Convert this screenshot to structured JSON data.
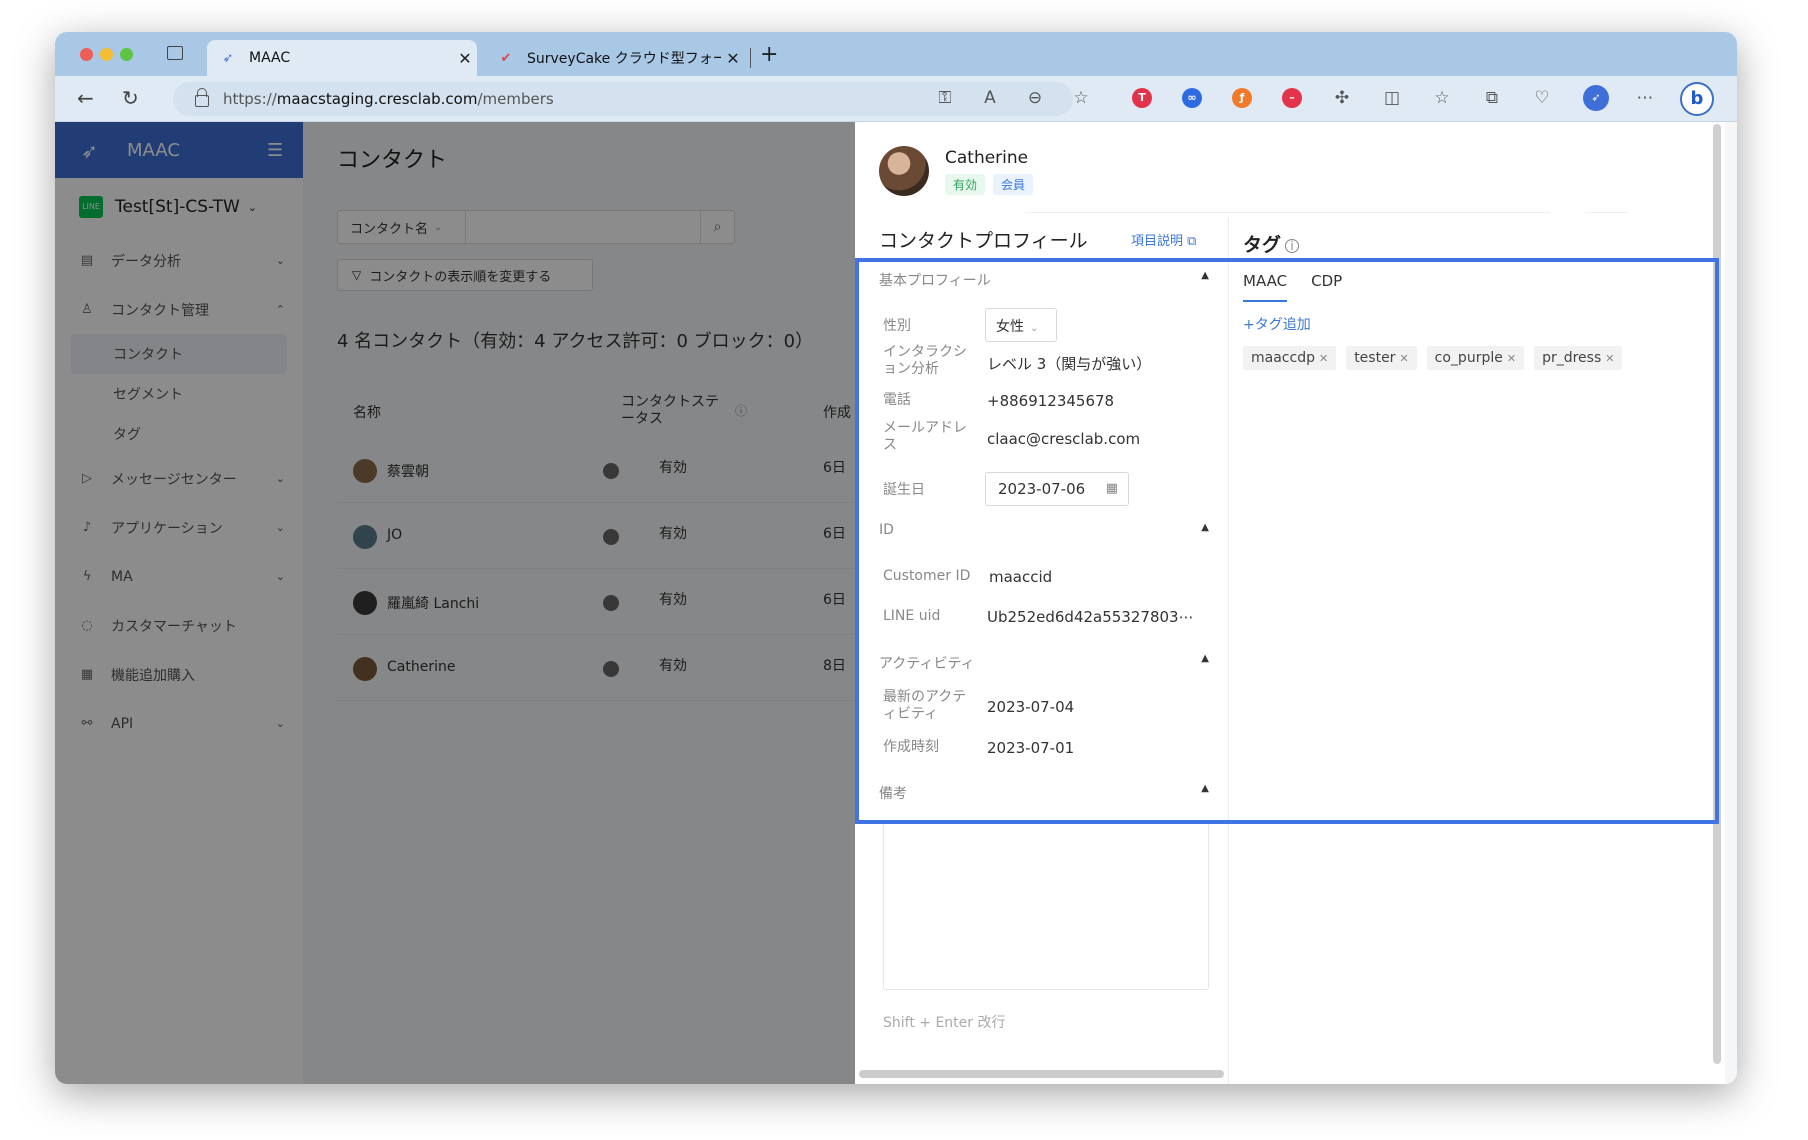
{
  "browser": {
    "tabs": [
      {
        "title": "MAAC",
        "active": true
      },
      {
        "title": "SurveyCake クラウド型フォー…",
        "active": false
      }
    ],
    "url_prefix": "https://",
    "url_host": "maacstaging.cresclab.com",
    "url_path": "/members"
  },
  "sidebar": {
    "brand": "MAAC",
    "workspace": "Test[St]-CS-TW",
    "line_badge": "LINE",
    "items": [
      {
        "label": "データ分析",
        "icon": "chart-icon"
      },
      {
        "label": "コンタクト管理",
        "icon": "user-icon"
      },
      {
        "label": "メッセージセンター",
        "icon": "send-icon"
      },
      {
        "label": "アプリケーション",
        "icon": "bell-icon"
      },
      {
        "label": "MA",
        "icon": "bolt-icon"
      },
      {
        "label": "カスタマーチャット",
        "icon": "chat-icon"
      },
      {
        "label": "機能追加購入",
        "icon": "store-icon"
      },
      {
        "label": "API",
        "icon": "link-icon"
      }
    ],
    "sub_items": [
      "コンタクト",
      "セグメント",
      "タグ"
    ]
  },
  "main": {
    "title": "コンタクト",
    "filter_select": "コンタクト名",
    "sort_button": "コンタクトの表示順を変更する",
    "summary": "4 名コンタクト（有効：4 アクセス許可：0 ブロック：0）",
    "col_name": "名称",
    "col_status": "コンタクトステータス",
    "col_created": "作成",
    "rows": [
      {
        "name": "蔡雲朝",
        "status": "有効",
        "date": "6日"
      },
      {
        "name": "JO",
        "status": "有効",
        "date": "6日"
      },
      {
        "name": "羅嵐綺 Lanchi",
        "status": "有効",
        "date": "6日"
      },
      {
        "name": "Catherine",
        "status": "有効",
        "date": "8日"
      }
    ]
  },
  "drawer": {
    "name": "Catherine",
    "badge_status": "有効",
    "badge_member": "会員",
    "profile_title": "コンタクトプロフィール",
    "profile_link": "項目説明",
    "basic_section": "基本プロフィール",
    "gender_label": "性別",
    "gender_value": "女性",
    "interaction_label": "インタラクション分析",
    "interaction_value": "レベル 3（関与が強い）",
    "phone_label": "電話",
    "phone_value": "+886912345678",
    "email_label": "メールアドレス",
    "email_value": "claac@cresclab.com",
    "birthday_label": "誕生日",
    "birthday_value": "2023-07-06",
    "id_section": "ID",
    "customer_id_label": "Customer ID",
    "customer_id_value": "maaccid",
    "line_uid_label": "LINE uid",
    "line_uid_value": "Ub252ed6d42a55327803⋯",
    "activity_section": "アクティビティ",
    "last_activity_label": "最新のアクティビティ",
    "last_activity_value": "2023-07-04",
    "created_label": "作成時刻",
    "created_value": "2023-07-01",
    "memo_section": "備考",
    "memo_hint": "Shift + Enter 改行",
    "tag_title": "タグ",
    "tag_tabs": [
      "MAAC",
      "CDP"
    ],
    "add_tag": "+タグ追加",
    "tags": [
      "maaccdp",
      "tester",
      "co_purple",
      "pr_dress"
    ]
  },
  "colors": {
    "accent": "#3e6fd8",
    "highlight_border": "#3f73e6",
    "link": "#3a78d8",
    "status_green": "#2ea55a"
  }
}
